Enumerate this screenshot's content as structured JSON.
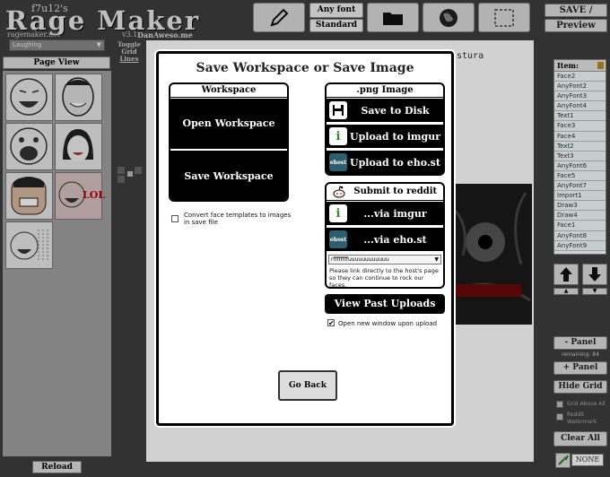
{
  "header": {
    "byline": "f7u12's",
    "title": "Rage Maker",
    "domain": "ragemaker.net",
    "version": "v3.1",
    "author": "DanAweso.me",
    "font_button": "Any font",
    "standard_button": "Standard",
    "save_load": "SAVE / LOAD",
    "preview": "Preview"
  },
  "left": {
    "category": "Laughing",
    "toggle_grid": [
      "Toggle",
      "Grid",
      "Lines"
    ],
    "page_view": "Page View",
    "lol_text": "LOL",
    "reload": "Reload"
  },
  "canvas": {
    "partial_text": "stura"
  },
  "right": {
    "item_header": "Item:",
    "items": [
      "Face2",
      "AnyFont2",
      "AnyFont3",
      "AnyFont4",
      "Text1",
      "Face3",
      "Face4",
      "Text2",
      "Text3",
      "AnyFont6",
      "Face5",
      "AnyFont7",
      "Import1",
      "Draw3",
      "Draw4",
      "Face1",
      "AnyFont8",
      "AnyFont9"
    ],
    "minus_panel": "- Panel",
    "remaining": "remaining: 84",
    "plus_panel": "+ Panel",
    "hide_grid": "Hide Grid",
    "grid_above_all": "Grid Above All",
    "reddit_watermark": "Reddit Watermark",
    "clear_all": "Clear All",
    "none": "NONE"
  },
  "modal": {
    "title": "Save Workspace or Save Image",
    "workspace": {
      "header": "Workspace",
      "open": "Open Workspace",
      "save": "Save Workspace",
      "convert_label": "Convert face templates to images in save file"
    },
    "png": {
      "header": ".png Image",
      "save_disk": "Save to Disk",
      "upload_imgur": "Upload to imgur",
      "upload_ehost": "Upload to eho.st"
    },
    "reddit": {
      "header": "Submit to reddit",
      "via_imgur": "...via imgur",
      "via_ehost": "...via eho.st",
      "select_value": "rffffffffuuuuuuuuuuuu",
      "note": "Please link directly to the host's page so they can continue to rock our faces."
    },
    "view_past": "View Past Uploads",
    "new_window": "Open new window upon upload",
    "go_back": "Go Back",
    "ehost_icon": "ehost",
    "info_icon": "i"
  }
}
